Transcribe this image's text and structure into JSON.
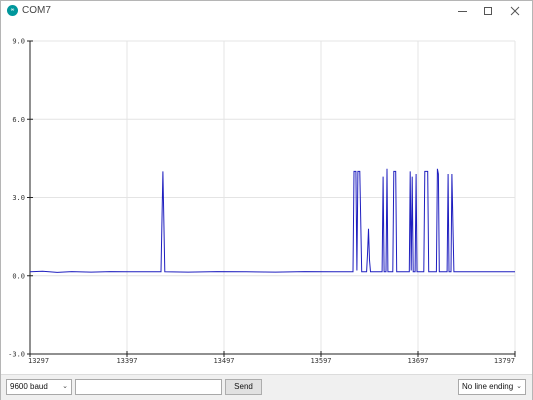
{
  "window": {
    "title": "COM7",
    "icon_text": "∞",
    "minimize_icon": "minimize-icon",
    "maximize_icon": "maximize-icon",
    "close_icon": "close-icon"
  },
  "chart_data": {
    "type": "line",
    "xlim": [
      13297,
      13797
    ],
    "ylim": [
      -3.0,
      9.0
    ],
    "x_ticks": [
      "13297",
      "13397",
      "13497",
      "13597",
      "13697",
      "13797"
    ],
    "y_ticks": [
      "9.0",
      "6.0",
      "3.0",
      "0.0",
      "-3.0"
    ],
    "grid": true,
    "line_color": "#1f1fbf",
    "series": [
      {
        "baseline": 0.15,
        "points": [
          [
            13297,
            0.15
          ],
          [
            13310,
            0.17
          ],
          [
            13325,
            0.13
          ],
          [
            13340,
            0.16
          ],
          [
            13360,
            0.14
          ],
          [
            13380,
            0.16
          ],
          [
            13400,
            0.15
          ],
          [
            13432,
            0.15
          ],
          [
            13433,
            2.0
          ],
          [
            13434,
            4.0
          ],
          [
            13435,
            2.0
          ],
          [
            13436,
            0.15
          ],
          [
            13460,
            0.14
          ],
          [
            13490,
            0.16
          ],
          [
            13520,
            0.15
          ],
          [
            13550,
            0.14
          ],
          [
            13580,
            0.16
          ],
          [
            13610,
            0.15
          ],
          [
            13630,
            0.15
          ],
          [
            13631,
            4.0
          ],
          [
            13633,
            4.0
          ],
          [
            13634,
            0.2
          ],
          [
            13635,
            4.0
          ],
          [
            13637,
            4.0
          ],
          [
            13639,
            0.15
          ],
          [
            13644,
            0.15
          ],
          [
            13645,
            0.9
          ],
          [
            13646,
            1.8
          ],
          [
            13647,
            0.6
          ],
          [
            13648,
            0.15
          ],
          [
            13660,
            0.15
          ],
          [
            13661,
            3.8
          ],
          [
            13662,
            0.15
          ],
          [
            13664,
            0.15
          ],
          [
            13665,
            4.1
          ],
          [
            13666,
            0.15
          ],
          [
            13671,
            0.15
          ],
          [
            13672,
            4.0
          ],
          [
            13674,
            4.0
          ],
          [
            13675,
            0.15
          ],
          [
            13688,
            0.15
          ],
          [
            13689,
            4.0
          ],
          [
            13690,
            0.2
          ],
          [
            13691,
            3.8
          ],
          [
            13692,
            0.15
          ],
          [
            13694,
            0.15
          ],
          [
            13695,
            3.9
          ],
          [
            13696,
            0.15
          ],
          [
            13703,
            0.15
          ],
          [
            13704,
            4.0
          ],
          [
            13707,
            4.0
          ],
          [
            13708,
            0.15
          ],
          [
            13716,
            0.15
          ],
          [
            13717,
            4.1
          ],
          [
            13718,
            3.9
          ],
          [
            13719,
            0.15
          ],
          [
            13727,
            0.15
          ],
          [
            13728,
            3.9
          ],
          [
            13729,
            0.15
          ],
          [
            13731,
            0.15
          ],
          [
            13732,
            3.9
          ],
          [
            13734,
            0.15
          ],
          [
            13750,
            0.15
          ],
          [
            13770,
            0.15
          ],
          [
            13797,
            0.15
          ]
        ]
      }
    ]
  },
  "bottom": {
    "baud": "9600 baud",
    "input_value": "",
    "send_label": "Send",
    "line_ending": "No line ending",
    "chevron": "⌄"
  }
}
